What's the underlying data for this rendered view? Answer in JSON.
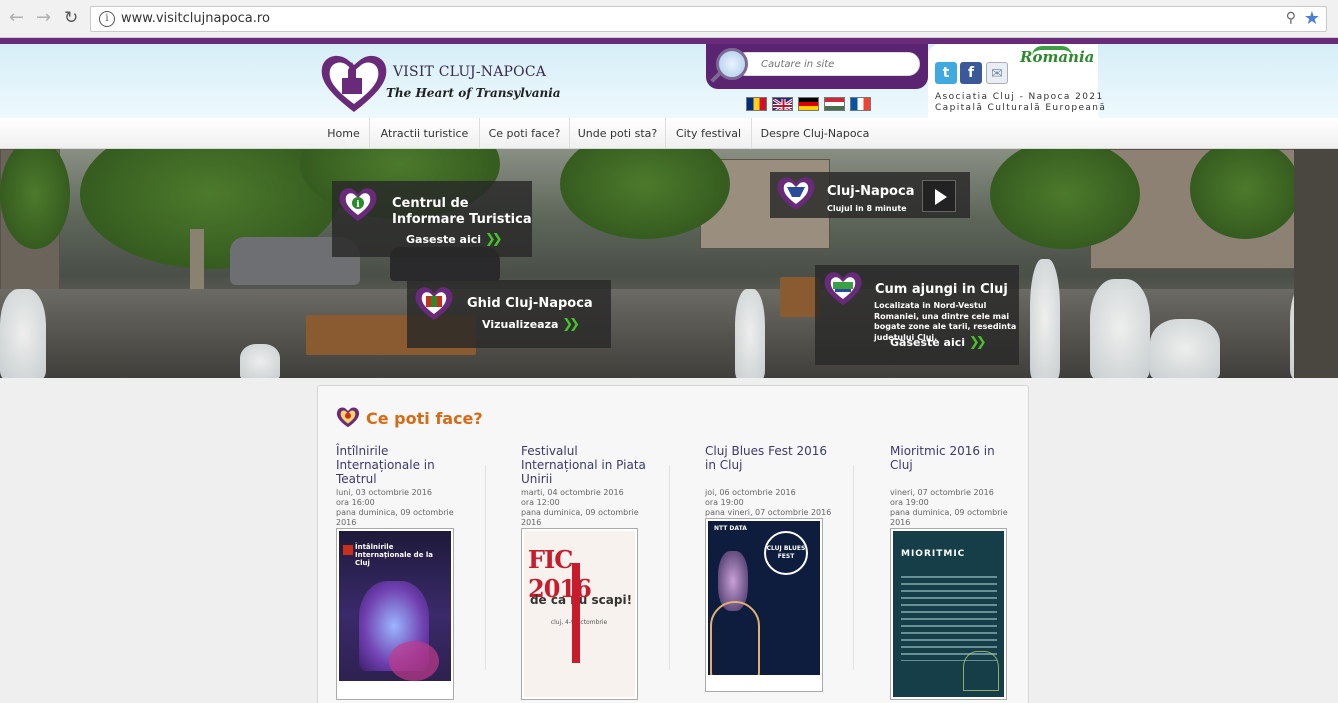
{
  "browser": {
    "url": "www.visitclujnapoca.ro",
    "back_icon": "arrow-left-icon",
    "forward_icon": "arrow-right-icon",
    "reload_icon": "reload-icon",
    "info_icon": "i"
  },
  "header": {
    "logo_title": "VISIT CLUJ-NAPOCA",
    "logo_subtitle": "The Heart of Transylvania",
    "search_placeholder": "Cautare in site",
    "flags": [
      "ro",
      "en",
      "de",
      "hu",
      "fr"
    ],
    "romania_logo": "Romania",
    "association_line1": "Asociatia Cluj - Napoca 2021",
    "association_line2": "Capitală Culturală Europeană"
  },
  "nav": {
    "items": [
      "Home",
      "Atractii turistice",
      "Ce poti face?",
      "Unde poti sta?",
      "City festival",
      "Despre Cluj-Napoca"
    ]
  },
  "hero": {
    "info_title": "Centrul de Informare Turistica",
    "info_link": "Gaseste aici",
    "video_title": "Cluj-Napoca",
    "video_sub": "Clujul in 8 minute",
    "guide_title": "Ghid Cluj-Napoca",
    "guide_link": "Vizualizeaza",
    "travel_title": "Cum ajungi in Cluj",
    "travel_desc": "Localizata in Nord-Vestul Romaniei, una dintre cele mai bogate zone ale tarii, resedinta judetului Cluj.",
    "travel_link": "Gaseste aici"
  },
  "section": {
    "title": "Ce poti face?",
    "events": [
      {
        "title": "Întîlnirile Internaționale in Teatrul",
        "date_start": "luni, 03 octombrie 2016",
        "time": "ora 16:00",
        "date_end": "pana duminica, 09 octombrie 2016"
      },
      {
        "title": "Festivalul Internațional in Piata Unirii",
        "date_start": "marti, 04 octombrie 2016",
        "time": "ora 12:00",
        "date_end": "pana duminica, 09 octombrie 2016"
      },
      {
        "title": "Cluj Blues Fest 2016 in Cluj",
        "date_start": "joi, 06 octombrie 2016",
        "time": "ora 19:00",
        "date_end": "pana vineri, 07 octombrie 2016"
      },
      {
        "title": "Mioritmic 2016 in Cluj",
        "date_start": "vineri, 07 octombrie 2016",
        "time": "ora 19:00",
        "date_end": "pana duminica, 09 octombrie 2016"
      }
    ],
    "posters": {
      "p1_text": "Întâlnirile Internaționale de la Cluj",
      "p2_top": "FIC 2016",
      "p2_mid": "de ca  nu scapi!",
      "p2_small": "cluj, 4-9 octombrie",
      "p3_brand": "NTT DATA",
      "p3_circle": "CLUJ BLUES FEST",
      "p4_title": "MIORITMIC"
    }
  },
  "colors": {
    "brand_purple": "#6a2a7a",
    "accent_orange": "#d86a16",
    "link_green": "#48c22c"
  }
}
